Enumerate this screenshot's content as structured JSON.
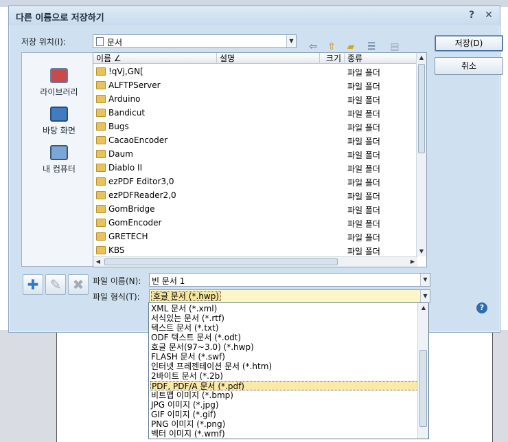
{
  "dialog": {
    "title": "다른 이름으로 저장하기",
    "help_glyph": "?",
    "close_glyph": "✕"
  },
  "location": {
    "label": "저장 위치(I):",
    "value": "문서"
  },
  "buttons": {
    "save": "저장(D)",
    "cancel": "취소"
  },
  "places": [
    {
      "label": "라이브러리"
    },
    {
      "label": "바탕 화면"
    },
    {
      "label": "내 컴퓨터"
    }
  ],
  "filelist": {
    "columns": [
      "이름 ∠",
      "설명",
      "크기",
      "종류"
    ],
    "rows": [
      {
        "name": "!qVj,GN[",
        "type": "파일 폴더"
      },
      {
        "name": "ALFTPServer",
        "type": "파일 폴더"
      },
      {
        "name": "Arduino",
        "type": "파일 폴더"
      },
      {
        "name": "Bandicut",
        "type": "파일 폴더"
      },
      {
        "name": "Bugs",
        "type": "파일 폴더"
      },
      {
        "name": "CacaoEncoder",
        "type": "파일 폴더"
      },
      {
        "name": "Daum",
        "type": "파일 폴더"
      },
      {
        "name": "Diablo II",
        "type": "파일 폴더"
      },
      {
        "name": "ezPDF Editor3,0",
        "type": "파일 폴더"
      },
      {
        "name": "ezPDFReader2,0",
        "type": "파일 폴더"
      },
      {
        "name": "GomBridge",
        "type": "파일 폴더"
      },
      {
        "name": "GomEncoder",
        "type": "파일 폴더"
      },
      {
        "name": "GRETECH",
        "type": "파일 폴더"
      },
      {
        "name": "KBS",
        "type": "파일 폴더"
      }
    ]
  },
  "filename": {
    "label": "파일 이름(N):",
    "value": "빈 문서 1"
  },
  "filetype": {
    "label": "파일 형식(T):",
    "value": "호글 문서 (*.hwp)",
    "options": [
      "XML 문서 (*.xml)",
      "서식있는 문서 (*.rtf)",
      "텍스트 문서 (*.txt)",
      "ODF 텍스트 문서 (*.odt)",
      "호글 문서(97~3.0) (*.hwp)",
      "FLASH 문서 (*.swf)",
      "인터넷 프레젠테이션 문서 (*.htm)",
      "2바이트 문서 (*.2b)",
      "PDF, PDF/A 문서 (*.pdf)",
      "비트맵 이미지 (*.bmp)",
      "JPG 이미지 (*.jpg)",
      "GIF 이미지 (*.gif)",
      "PNG 이미지 (*.png)",
      "벡터 이미지 (*.wmf)"
    ],
    "highlighted_option": "PDF, PDF/A 문서 (*.pdf)"
  },
  "colors": {
    "dialog_bg": "#cfe1f0",
    "highlight": "#fbe9a8",
    "folder": "#e8c25a"
  }
}
